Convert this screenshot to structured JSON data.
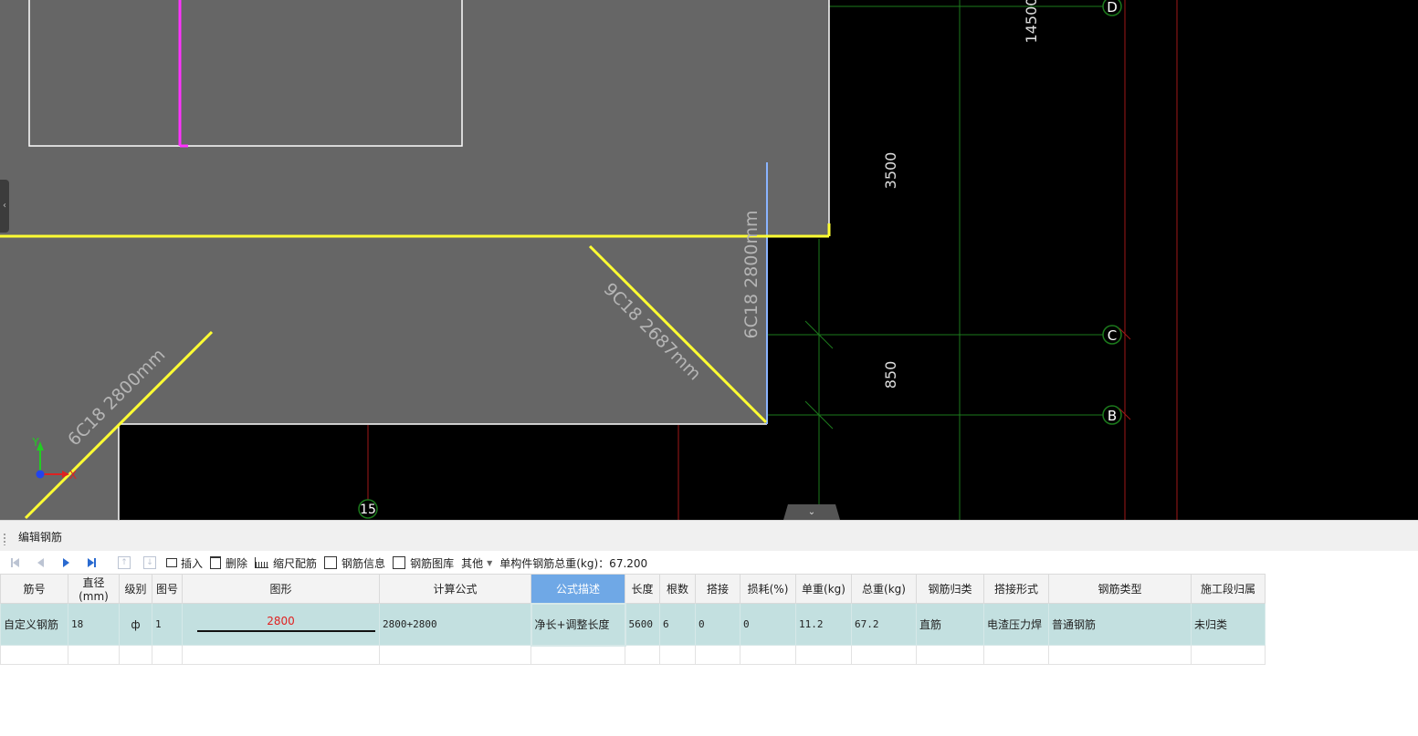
{
  "canvas": {
    "texts": {
      "dim_14500": "14500",
      "dim_3500": "3500",
      "dim_850": "850",
      "axis_d": "D",
      "axis_c": "C",
      "axis_b": "B",
      "axis_15": "15",
      "rebar_1": "6C18 2800mm",
      "rebar_2": "6C18 2800mm",
      "rebar_3": "9C18 2687mm",
      "ucs_x": "X",
      "ucs_y": "Y"
    },
    "colors": {
      "background": "#000000",
      "slab": "#666666",
      "rebar": "#ffff33",
      "grid_line": "#1c7a1c",
      "axis_red": "#a01818",
      "magenta": "#ff33ff",
      "edge_blue": "#8ab4ff"
    }
  },
  "panel": {
    "title": "编辑钢筋",
    "toolbar": {
      "insert": "插入",
      "delete": "删除",
      "scale_rebar": "缩尺配筋",
      "rebar_info": "钢筋信息",
      "rebar_library": "钢筋图库",
      "other": "其他",
      "total_weight": "单构件钢筋总重(kg)：67.200"
    },
    "columns": [
      "筋号",
      "直径(mm)",
      "级别",
      "图号",
      "图形",
      "计算公式",
      "公式描述",
      "长度",
      "根数",
      "搭接",
      "损耗(%)",
      "单重(kg)",
      "总重(kg)",
      "钢筋归类",
      "搭接形式",
      "钢筋类型",
      "施工段归属"
    ],
    "rows": [
      {
        "name": "自定义钢筋",
        "diameter": "18",
        "grade": "ф",
        "fig_no": "1",
        "shape_value": "2800",
        "formula": "2800+2800",
        "formula_desc": "净长+调整长度",
        "length": "5600",
        "count": "6",
        "lap": "0",
        "loss": "0",
        "unit_weight": "11.2",
        "total_weight": "67.2",
        "category": "直筋",
        "lap_type": "电渣压力焊",
        "rebar_type": "普通钢筋",
        "stage": "未归类"
      }
    ]
  }
}
